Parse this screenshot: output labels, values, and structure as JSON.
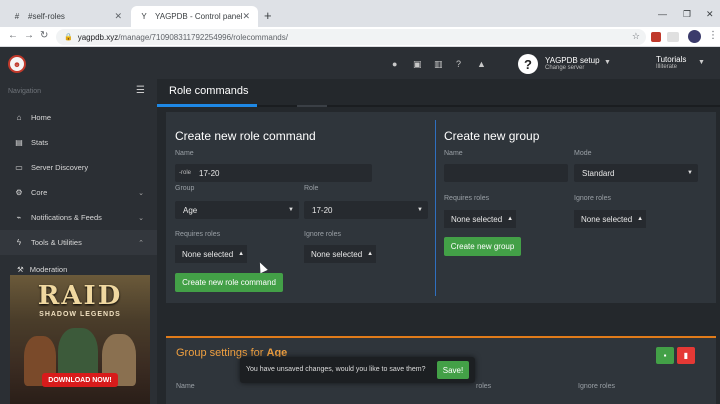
{
  "browser": {
    "tabs": [
      {
        "title": "#self-roles",
        "favicon": "#",
        "active": false
      },
      {
        "title": "YAGPDB - Control panel",
        "favicon": "Y",
        "active": true
      }
    ],
    "url_host": "yagpdb.xyz",
    "url_path": "/manage/710908311792254996/rolecommands/"
  },
  "header": {
    "server_name": "YAGPDB setup",
    "server_sub": "Change server",
    "tutorials": "Tutorials",
    "user": "Illiterate"
  },
  "sidebar": {
    "heading": "Navigation",
    "items": [
      {
        "label": "Home",
        "icon": "home-icon",
        "glyph": "⌂"
      },
      {
        "label": "Stats",
        "icon": "stats-icon",
        "glyph": "▤"
      },
      {
        "label": "Server Discovery",
        "icon": "discovery-icon",
        "glyph": "▭"
      },
      {
        "label": "Core",
        "icon": "cogs-icon",
        "glyph": "⚙"
      },
      {
        "label": "Notifications & Feeds",
        "icon": "rss-icon",
        "glyph": "⌁"
      },
      {
        "label": "Tools & Utilities",
        "icon": "bolt-icon",
        "glyph": "ϟ"
      }
    ],
    "subitem": "Moderation"
  },
  "ad": {
    "title": "RAID",
    "subtitle": "SHADOW LEGENDS",
    "cta": "DOWNLOAD NOW!"
  },
  "page": {
    "title": "Role commands"
  },
  "create_command": {
    "heading": "Create new role command",
    "name_label": "Name",
    "name_prefix": "-role",
    "name_value": "17-20",
    "group_label": "Group",
    "group_value": "Age",
    "role_label": "Role",
    "role_value": "17-20",
    "requires_label": "Requires roles",
    "requires_value": "None selected",
    "ignore_label": "Ignore roles",
    "ignore_value": "None selected",
    "button": "Create new role command"
  },
  "create_group": {
    "heading": "Create new group",
    "name_label": "Name",
    "mode_label": "Mode",
    "mode_value": "Standard",
    "requires_label": "Requires roles",
    "requires_value": "None selected",
    "ignore_label": "Ignore roles",
    "ignore_value": "None selected",
    "button": "Create new group"
  },
  "group_settings": {
    "heading_prefix": "Group settings for",
    "group": "Age",
    "cols": [
      "Name",
      "roles",
      "Ignore roles"
    ]
  },
  "toast": {
    "message": "You have unsaved changes, would you like to save them?",
    "save": "Save!"
  },
  "colors": {
    "accent_green": "#43a047",
    "accent_blue": "#1e88e5",
    "accent_orange": "#e07b1a",
    "danger": "#e53935"
  }
}
